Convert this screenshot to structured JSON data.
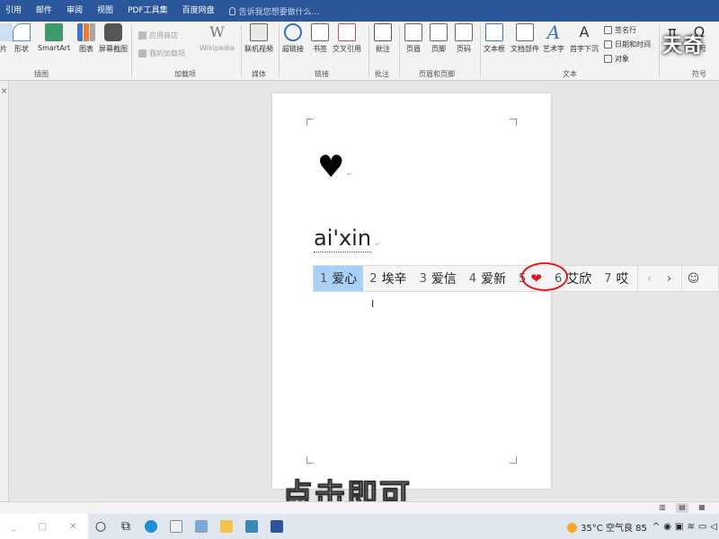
{
  "ribbon_tabs": [
    "引用",
    "邮件",
    "审阅",
    "视图",
    "PDF工具集",
    "百度网盘"
  ],
  "tell_me": "告诉我您想要做什么...",
  "ribbon": {
    "buttons": {
      "shapes": "形状",
      "smartart": "SmartArt",
      "chart": "图表",
      "screenshot": "屏幕截图",
      "app_store": "应用商店",
      "my_addins": "我的加载项",
      "wikipedia": "Wikipedia",
      "online_video": "联机视频",
      "hyperlink": "超链接",
      "bookmark": "书签",
      "cross_ref": "交叉引用",
      "comment": "批注",
      "header": "页眉",
      "footer": "页脚",
      "page_number": "页码",
      "textbox": "文本框",
      "quick_parts": "文档部件",
      "wordart": "艺术字",
      "dropcap": "首字下沉",
      "signature_line": "签名行",
      "date_time": "日期和时间",
      "object": "对象",
      "equation": "公式",
      "symbol": "符号",
      "pic_partial": "片"
    },
    "groups": {
      "illustrations": "插图",
      "addins": "加载项",
      "media": "媒体",
      "links": "链接",
      "comments": "批注",
      "header_footer": "页眉和页脚",
      "text": "文本",
      "symbols": "符号"
    }
  },
  "logo": "天奇",
  "document": {
    "heart": "♥",
    "typed_pinyin": "ai'xin"
  },
  "ime": {
    "candidates": [
      {
        "num": "1",
        "text": "爱心"
      },
      {
        "num": "2",
        "text": "埃辛"
      },
      {
        "num": "3",
        "text": "爱信"
      },
      {
        "num": "4",
        "text": "爱新"
      },
      {
        "num": "5",
        "text": "❤"
      },
      {
        "num": "6",
        "text": "艾欣"
      },
      {
        "num": "7",
        "text": "哎"
      }
    ],
    "selected_index": 0,
    "prev": "‹",
    "next": "›",
    "emoji": "☺"
  },
  "subtitle": "点击即可",
  "taskbar": {
    "search_box_controls": [
      "_",
      "□",
      "✕"
    ],
    "weather": "35°C 空气良 85",
    "tray_caret": "^"
  },
  "colors": {
    "ribbon_blue": "#2b579a",
    "ime_selected": "#a9d0f5",
    "annotation_red": "#e31b1b"
  }
}
